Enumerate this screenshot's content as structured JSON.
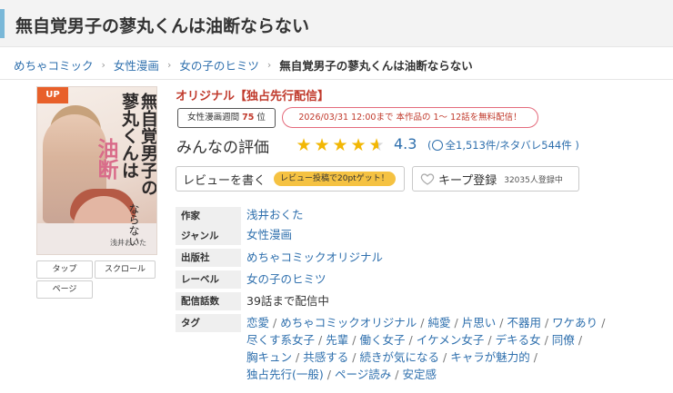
{
  "page": {
    "title": "無自覚男子の蓼丸くんは油断ならない"
  },
  "breadcrumb": {
    "items": [
      "めちゃコミック",
      "女性漫画",
      "女の子のヒミツ"
    ],
    "current": "無自覚男子の蓼丸くんは油断ならない",
    "separator": "›"
  },
  "cover": {
    "badge": "UP",
    "title_line1": "無自覚男子の",
    "title_line2": "蓼丸くんは",
    "title_line3": "油断",
    "title_line4": "ならない",
    "author": "浅井おくた"
  },
  "view_buttons": {
    "tap": "タップ",
    "scroll": "スクロール",
    "page": "ページ"
  },
  "product": {
    "label": "オリジナル【独占先行配信】",
    "rank_prefix": "女性漫画週間",
    "rank_number": "75",
    "rank_suffix": "位",
    "free_notice": "2026/03/31 12:00まで 本作品の 1〜 12話を無料配信！"
  },
  "rating": {
    "title": "みんなの評価",
    "score": "4.3",
    "stars_value": 4.3,
    "review_summary": "全1,513件/ネタバレ544件 )",
    "review_prefix": "("
  },
  "actions": {
    "review_button": "レビューを書く",
    "review_bonus": "レビュー投稿で20ptゲット！",
    "keep_button": "キープ登録",
    "keep_count": "32035人登録中"
  },
  "info": {
    "author_label": "作家",
    "author": "浅井おくた",
    "genre_label": "ジャンル",
    "genre": "女性漫画",
    "publisher_label": "出版社",
    "publisher": "めちゃコミックオリジナル",
    "label_label": "レーベル",
    "label": "女の子のヒミツ",
    "episodes_label": "配信話数",
    "episodes": "39話まで配信中",
    "tags_label": "タグ",
    "tags": [
      "恋愛",
      "めちゃコミックオリジナル",
      "純愛",
      "片思い",
      "不器用",
      "ワケあり",
      "尽くす系女子",
      "先輩",
      "働く女子",
      "イケメン女子",
      "デキる女",
      "同僚",
      "胸キュン",
      "共感する",
      "続きが気になる",
      "キャラが魅力的",
      "独占先行(一般)",
      "ページ読み",
      "安定感"
    ]
  },
  "colors": {
    "link": "#2e6fad",
    "accent_red": "#c0392b",
    "star": "#f2b705",
    "badge_orange": "#e8602a",
    "pill_yellow": "#f5c242",
    "title_accent": "#7ab8d8"
  }
}
